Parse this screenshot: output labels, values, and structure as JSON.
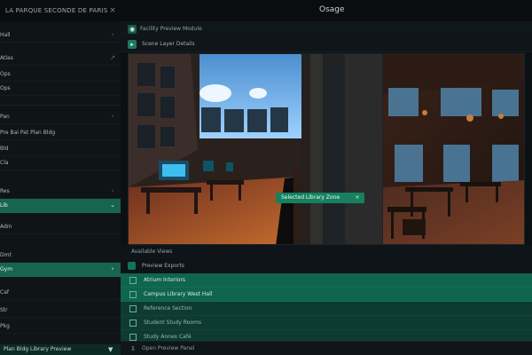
{
  "topbar": {
    "brand": "LA PARQUE SECONDE DE PARIS",
    "title": "Osage"
  },
  "sidebar": {
    "items": [
      {
        "label": "Hall",
        "state": "normal"
      },
      {
        "label": "Atlas",
        "state": "normal"
      },
      {
        "label": "Ops",
        "state": "normal"
      },
      {
        "label": "Ops",
        "state": "normal"
      },
      {
        "label": "Pan",
        "state": "normal"
      },
      {
        "label": "Pre Bai Pat Plan Bldg",
        "state": "normal"
      },
      {
        "label": "Bld",
        "state": "normal"
      },
      {
        "label": "Cla",
        "state": "normal"
      },
      {
        "label": "Res",
        "state": "active"
      },
      {
        "label": "Lib",
        "state": "normal"
      },
      {
        "label": "Adm",
        "state": "normal"
      },
      {
        "label": "Dmt",
        "state": "active"
      },
      {
        "label": "Gym",
        "state": "normal"
      },
      {
        "label": "Caf",
        "state": "normal"
      },
      {
        "label": "Str",
        "state": "normal"
      },
      {
        "label": "Pkg",
        "state": "normal"
      }
    ],
    "bottom_label": "Plan Bldg Library Preview"
  },
  "main": {
    "header_text": "Facility Preview Module",
    "subheader_text": "Scene Layer Details",
    "callout_text": "Selected Library Zone",
    "list_header": "Available Views",
    "list_subheader": "Preview Exports",
    "rows": [
      {
        "label": "Atrium Interiors",
        "selected": true
      },
      {
        "label": "Campus Library West Hall",
        "selected": true
      },
      {
        "label": "Reference Section",
        "selected": false
      },
      {
        "label": "Student Study Rooms",
        "selected": false
      },
      {
        "label": "Study Annex Café",
        "selected": false
      }
    ],
    "footer_text": "Open Preview Panel"
  },
  "colors": {
    "accent": "#16805f",
    "accent_dark": "#0f654f",
    "accent_soft": "#0d3b31"
  },
  "icons": {
    "close": "close-icon",
    "chevron": "chevron-right-icon",
    "download": "download-icon"
  }
}
